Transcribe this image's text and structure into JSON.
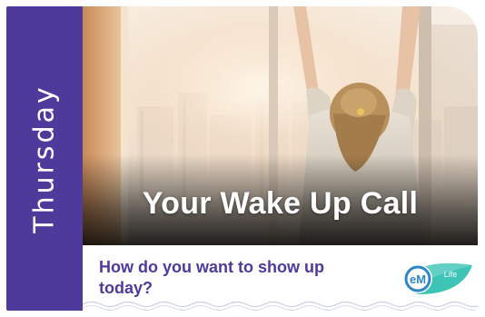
{
  "card": {
    "day": "Thursday",
    "headline": "Your Wake Up Call",
    "question": "How do you want to show up today?",
    "logo": {
      "initials": "eM",
      "brand_word": "Life",
      "icon": "leaf-logo-icon"
    }
  },
  "colors": {
    "brand_purple": "#4e3a9b",
    "logo_teal": "#3ec3b7",
    "logo_blue": "#2e87c5",
    "background": "#ffffff"
  }
}
